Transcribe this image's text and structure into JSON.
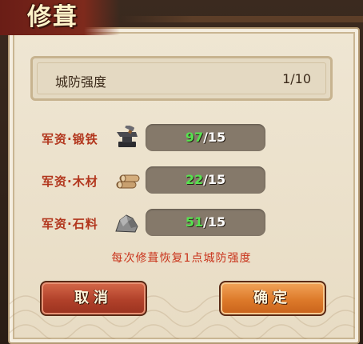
{
  "dialog": {
    "title": "修葺"
  },
  "defense": {
    "label": "城防强度",
    "value": "1/10"
  },
  "resources": [
    {
      "label": "军资·锻铁",
      "have": "97",
      "sep": "/",
      "need": "15",
      "icon": "anvil-icon"
    },
    {
      "label": "军资·木材",
      "have": "22",
      "sep": "/",
      "need": "15",
      "icon": "wood-logs-icon"
    },
    {
      "label": "军资·石料",
      "have": "51",
      "sep": "/",
      "need": "15",
      "icon": "stone-icon"
    }
  ],
  "note": "每次修葺恢复1点城防强度",
  "buttons": {
    "cancel": "取消",
    "confirm": "确定"
  },
  "colors": {
    "accent_red": "#b2361d",
    "have_green": "#57e24f",
    "cancel_button": "#b1412a",
    "confirm_button": "#dd7a2a"
  }
}
